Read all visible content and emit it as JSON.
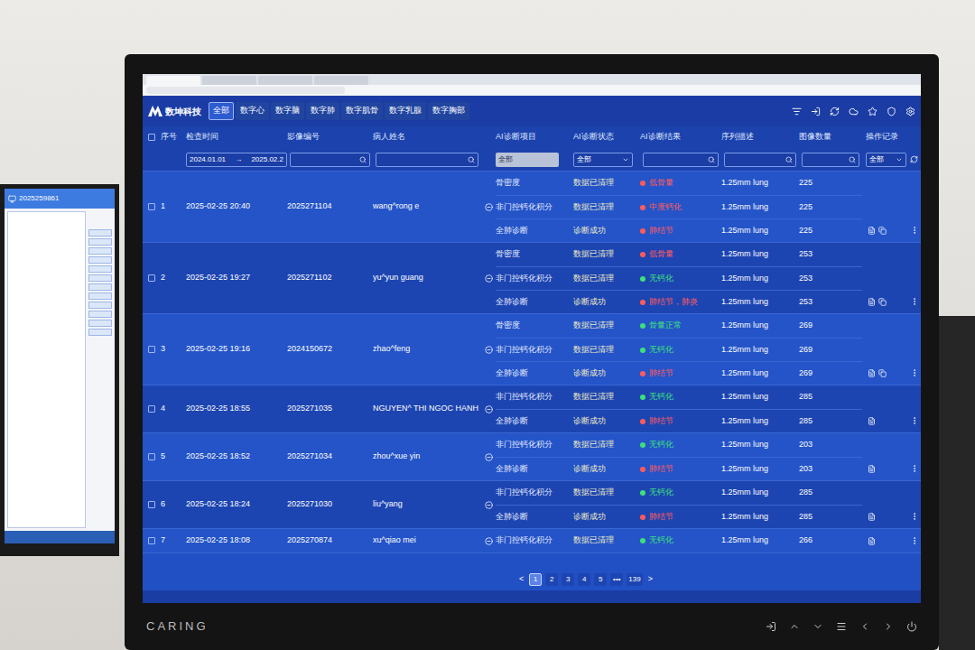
{
  "left_monitor": {
    "title": "2025259861"
  },
  "app": {
    "logo": "数坤科技",
    "nav_tabs": [
      {
        "label": "全部",
        "selected": true
      },
      {
        "label": "数字心",
        "selected": false
      },
      {
        "label": "数字脑",
        "selected": false
      },
      {
        "label": "数字肺",
        "selected": false
      },
      {
        "label": "数字肌骨",
        "selected": false
      },
      {
        "label": "数字乳腺",
        "selected": false
      },
      {
        "label": "数字胸部",
        "selected": false
      }
    ]
  },
  "table": {
    "columns": [
      "序号",
      "检查时间",
      "影像编号",
      "病人姓名",
      "AI诊断项目",
      "AI诊断状态",
      "AI诊断结果",
      "序列描述",
      "图像数量",
      "操作记录"
    ],
    "filters": {
      "date_from": "2024.01.01",
      "date_arrow": "→",
      "date_to": "2025.02.2",
      "project": "全部",
      "status": "全部",
      "operation": "全部"
    },
    "rows": [
      {
        "index": "1",
        "time": "2025-02-25 20:40",
        "id": "2025271104",
        "name": "wang^rong e",
        "ops_icons": 2,
        "items": [
          {
            "project": "骨密度",
            "status": "数据已清理",
            "result": "低骨量",
            "color": "#ff5b5b",
            "series": "1.25mm lung",
            "count": "225"
          },
          {
            "project": "非门控钙化积分",
            "status": "数据已清理",
            "result": "中度钙化",
            "color": "#ff5b5b",
            "series": "1.25mm lung",
            "count": "225"
          },
          {
            "project": "全肺诊断",
            "status": "诊断成功",
            "result": "肺结节",
            "color": "#ff5b5b",
            "series": "1.25mm lung",
            "count": "225"
          }
        ]
      },
      {
        "index": "2",
        "time": "2025-02-25 19:27",
        "id": "2025271102",
        "name": "yu^yun guang",
        "ops_icons": 2,
        "items": [
          {
            "project": "骨密度",
            "status": "数据已清理",
            "result": "低骨量",
            "color": "#ff5b5b",
            "series": "1.25mm lung",
            "count": "253"
          },
          {
            "project": "非门控钙化积分",
            "status": "数据已清理",
            "result": "无钙化",
            "color": "#3ee07a",
            "series": "1.25mm lung",
            "count": "253"
          },
          {
            "project": "全肺诊断",
            "status": "诊断成功",
            "result": "肺结节，肺炎",
            "color": "#ff5b5b",
            "series": "1.25mm lung",
            "count": "253"
          }
        ]
      },
      {
        "index": "3",
        "time": "2025-02-25 19:16",
        "id": "2024150672",
        "name": "zhao^feng",
        "ops_icons": 2,
        "items": [
          {
            "project": "骨密度",
            "status": "数据已清理",
            "result": "骨量正常",
            "color": "#3ee07a",
            "series": "1.25mm lung",
            "count": "269"
          },
          {
            "project": "非门控钙化积分",
            "status": "数据已清理",
            "result": "无钙化",
            "color": "#3ee07a",
            "series": "1.25mm lung",
            "count": "269"
          },
          {
            "project": "全肺诊断",
            "status": "诊断成功",
            "result": "肺结节",
            "color": "#ff5b5b",
            "series": "1.25mm lung",
            "count": "269"
          }
        ]
      },
      {
        "index": "4",
        "time": "2025-02-25 18:55",
        "id": "2025271035",
        "name": "NGUYEN^ THI NGOC HANH",
        "ops_icons": 1,
        "items": [
          {
            "project": "非门控钙化积分",
            "status": "数据已清理",
            "result": "无钙化",
            "color": "#3ee07a",
            "series": "1.25mm lung",
            "count": "285"
          },
          {
            "project": "全肺诊断",
            "status": "诊断成功",
            "result": "肺结节",
            "color": "#ff5b5b",
            "series": "1.25mm lung",
            "count": "285"
          }
        ]
      },
      {
        "index": "5",
        "time": "2025-02-25 18:52",
        "id": "2025271034",
        "name": "zhou^xue yin",
        "ops_icons": 1,
        "items": [
          {
            "project": "非门控钙化积分",
            "status": "数据已清理",
            "result": "无钙化",
            "color": "#3ee07a",
            "series": "1.25mm lung",
            "count": "203"
          },
          {
            "project": "全肺诊断",
            "status": "诊断成功",
            "result": "肺结节",
            "color": "#ff5b5b",
            "series": "1.25mm lung",
            "count": "203"
          }
        ]
      },
      {
        "index": "6",
        "time": "2025-02-25 18:24",
        "id": "2025271030",
        "name": "liu^yang",
        "ops_icons": 1,
        "items": [
          {
            "project": "非门控钙化积分",
            "status": "数据已清理",
            "result": "无钙化",
            "color": "#3ee07a",
            "series": "1.25mm lung",
            "count": "285"
          },
          {
            "project": "全肺诊断",
            "status": "诊断成功",
            "result": "肺结节",
            "color": "#ff5b5b",
            "series": "1.25mm lung",
            "count": "285"
          }
        ]
      },
      {
        "index": "7",
        "time": "2025-02-25 18:08",
        "id": "2025270874",
        "name": "xu^qiao mei",
        "ops_icons": 1,
        "items": [
          {
            "project": "非门控钙化积分",
            "status": "数据已清理",
            "result": "无钙化",
            "color": "#3ee07a",
            "series": "1.25mm lung",
            "count": "266"
          }
        ]
      }
    ]
  },
  "pagination": {
    "prev": "<",
    "pages": [
      {
        "label": "1",
        "selected": true
      },
      {
        "label": "2",
        "selected": false
      },
      {
        "label": "3",
        "selected": false
      },
      {
        "label": "4",
        "selected": false
      },
      {
        "label": "5",
        "selected": false
      },
      {
        "label": "•••",
        "selected": false
      },
      {
        "label": "139",
        "selected": false
      }
    ],
    "next": ">"
  },
  "monitor": {
    "brand": "CARING"
  }
}
